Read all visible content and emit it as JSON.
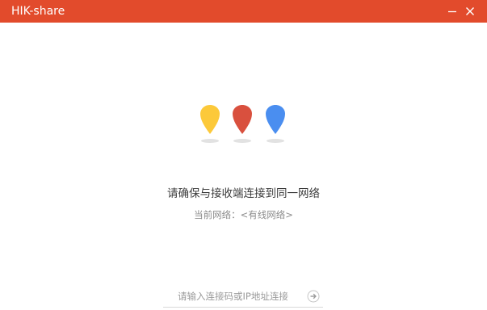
{
  "window": {
    "title": "HIK-share",
    "accent_color": "#e24b2c",
    "controls": [
      "minimize-icon",
      "close-icon"
    ]
  },
  "hero": {
    "pins": [
      {
        "name": "yellow-pin-icon",
        "color": "#fcc93a"
      },
      {
        "name": "red-pin-icon",
        "color": "#d9503e"
      },
      {
        "name": "blue-pin-icon",
        "color": "#4a8ef0"
      }
    ]
  },
  "status": {
    "message": "请确保与接收端连接到同一网络",
    "network_label": "当前网络：",
    "network_value": "<有线网络>"
  },
  "connect": {
    "placeholder": "请输入连接码或IP地址连接",
    "go_icon": "arrow-right-circle-icon"
  }
}
